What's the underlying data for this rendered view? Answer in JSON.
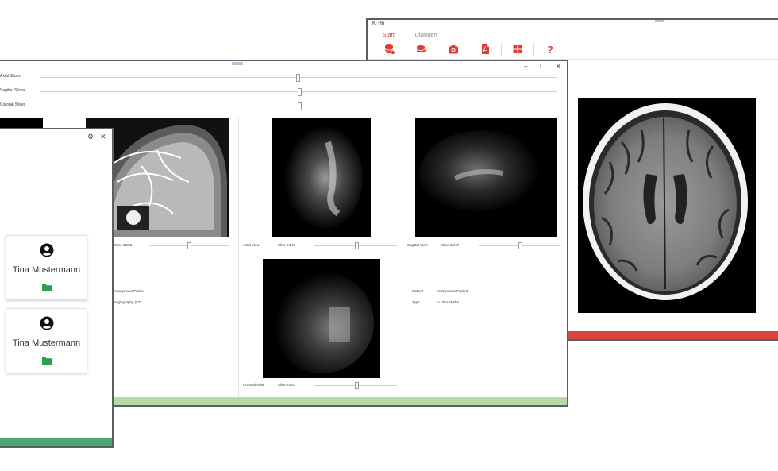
{
  "back_window": {
    "title": "KI Hb",
    "tabs": [
      {
        "label": "Start",
        "active": true
      },
      {
        "label": "Dialogen",
        "active": false
      }
    ],
    "toolbar": [
      {
        "icon": "database-add-icon"
      },
      {
        "icon": "database-sync-icon"
      },
      {
        "icon": "camera-icon"
      },
      {
        "icon": "pdf-file-icon"
      },
      {
        "icon": "layout-grid-icon"
      },
      {
        "icon": "help-icon",
        "label": "?"
      }
    ],
    "accent_color": "#d9433b"
  },
  "mid_window": {
    "controls": {
      "minimize": "–",
      "maximize": "☐",
      "close": "✕"
    },
    "sliders": [
      {
        "label": "Axial Slices",
        "value": 0.5
      },
      {
        "label": "Sagittal Slices",
        "value": 0.5
      },
      {
        "label": "Coronal Slices",
        "value": 0.5
      }
    ],
    "views": {
      "left": {
        "slice_label": "Slice 36/56",
        "info": [
          "Anonymous Patient",
          "Angiography (CT)"
        ]
      },
      "axial": {
        "name": "Axial View",
        "slice_label": "Slice 24/47"
      },
      "sagittal": {
        "name": "Sagittal View",
        "slice_label": "Slice 24/47"
      },
      "coronal": {
        "name": "Coronal View",
        "slice_label": "Slice 24/47"
      }
    },
    "patient_info": [
      {
        "key": "Patient",
        "value": "Anonymous Patient"
      },
      {
        "key": "Type",
        "value": "In Vitro Model"
      }
    ],
    "accent_color": "#b7d9a6"
  },
  "front_window": {
    "controls": {
      "settings": "⚙",
      "close": "✕"
    },
    "patients": [
      {
        "name": "Tina Mustermann",
        "icon": "account-circle-icon",
        "folder_icon": "folder-icon"
      },
      {
        "name": "Tina Mustermann",
        "icon": "account-circle-icon",
        "folder_icon": "folder-icon"
      }
    ],
    "accent_color": "#4ea56e"
  }
}
